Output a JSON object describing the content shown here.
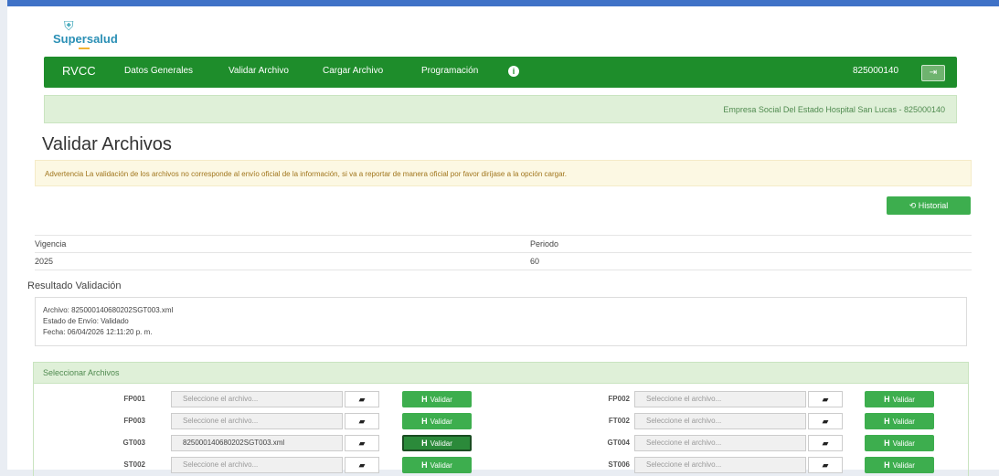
{
  "logo": {
    "name": "Supersalud",
    "glyph": "⛨"
  },
  "nav": {
    "brand": "RVCC",
    "items": [
      "Datos Generales",
      "Validar Archivo",
      "Cargar Archivo",
      "Programación"
    ],
    "info_icon": "i",
    "user_nit": "825000140",
    "logout_icon": "⇥"
  },
  "entity_banner": "Empresa Social Del Estado Hospital San Lucas - 825000140",
  "page_title": "Validar Archivos",
  "warning": "Advertencia La validación de los archivos no corresponde al envío oficial de la información, si va a reportar de manera oficial por favor diríjase a la opción cargar.",
  "history_button": "⟲ Historial",
  "period_table": {
    "headers": [
      "Vigencia",
      "Periodo"
    ],
    "values": [
      "2025",
      "60"
    ]
  },
  "result": {
    "title": "Resultado Validación",
    "archivo": "Archivo: 825000140680202SGT003.xml",
    "estado": "Estado de Envío: Validado",
    "fecha": "Fecha: 06/04/2026 12:11:20 p. m."
  },
  "select_files": {
    "title": "Seleccionar Archivos",
    "folder_icon": "▰",
    "validate_label": "Validar",
    "validate_icon": "H",
    "rows": [
      {
        "left_code": "FP001",
        "left_value": "Seleccione el archivo...",
        "right_code": "FP002",
        "right_value": "Seleccione el archivo..."
      },
      {
        "left_code": "FP003",
        "left_value": "Seleccione el archivo...",
        "right_code": "FT002",
        "right_value": "Seleccione el archivo..."
      },
      {
        "left_code": "GT003",
        "left_value": "825000140680202SGT003.xml",
        "right_code": "GT004",
        "right_value": "Seleccione el archivo..."
      },
      {
        "left_code": "ST002",
        "left_value": "Seleccione el archivo...",
        "right_code": "ST006",
        "right_value": "Seleccione el archivo..."
      }
    ]
  }
}
